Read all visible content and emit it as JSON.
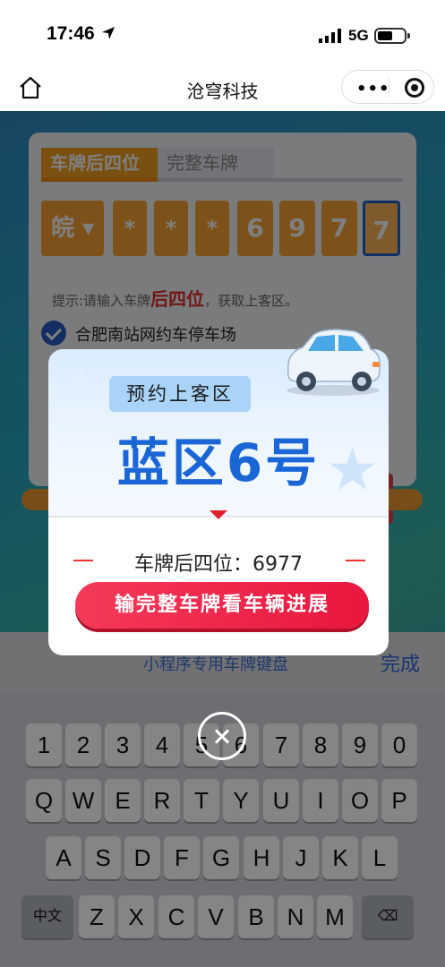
{
  "status_bar": {
    "time": "17:46",
    "network": "5G"
  },
  "navbar": {
    "title": "沧穹科技"
  },
  "tabs": [
    {
      "label": "车牌后四位"
    },
    {
      "label": "完整车牌"
    }
  ],
  "plate_chars": [
    "皖 ▾",
    "*",
    "*",
    "*",
    "6",
    "9",
    "7",
    "7"
  ],
  "hint": {
    "prefix": "提示:请输入车牌",
    "highlight": "后四位",
    "suffix": "，获取上客区。"
  },
  "station": "合肥南站网约车停车场",
  "modal": {
    "tag": "预约上客区",
    "zone": "蓝区6号",
    "plate_info": "车牌后四位：6977",
    "cta": "输完整车牌看车辆进展"
  },
  "keyboard": {
    "label": "小程序专用车牌键盘",
    "done": "完成",
    "row1": [
      "1",
      "2",
      "3",
      "4",
      "5",
      "6",
      "7",
      "8",
      "9",
      "0"
    ],
    "row2": [
      "Q",
      "W",
      "E",
      "R",
      "T",
      "Y",
      "U",
      "I",
      "O",
      "P"
    ],
    "row3": [
      "A",
      "S",
      "D",
      "F",
      "G",
      "H",
      "J",
      "K",
      "L"
    ],
    "row4": [
      "中文",
      "Z",
      "X",
      "C",
      "V",
      "B",
      "N",
      "M",
      "⌫"
    ]
  },
  "icons": {
    "home": "home-icon",
    "more": "more-icon",
    "target": "target-icon",
    "close": "close-icon",
    "car": "car-icon"
  },
  "colors": {
    "accent": "#f4a020",
    "zone": "#1a66d6",
    "cta": "#e8163e",
    "check": "#2a5cc4"
  }
}
